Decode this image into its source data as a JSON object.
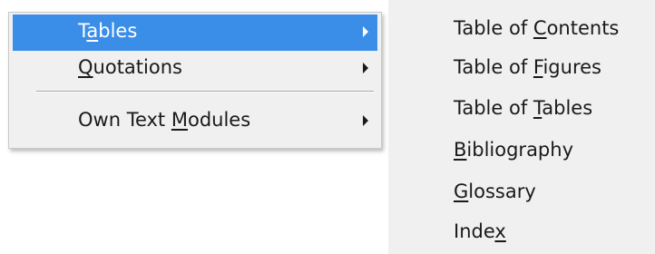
{
  "main_menu": {
    "items": [
      {
        "pre": "T",
        "key": "a",
        "post": "bles",
        "has_submenu": true,
        "selected": true
      },
      {
        "pre": "",
        "key": "Q",
        "post": "uotations",
        "has_submenu": true,
        "selected": false
      },
      {
        "pre": "Own Text ",
        "key": "M",
        "post": "odules",
        "has_submenu": true,
        "selected": false
      }
    ]
  },
  "submenu": {
    "items": [
      {
        "pre": "Table of ",
        "key": "C",
        "post": "ontents"
      },
      {
        "pre": "Table of ",
        "key": "F",
        "post": "igures"
      },
      {
        "pre": "Table of ",
        "key": "T",
        "post": "ables"
      },
      {
        "pre": "",
        "key": "B",
        "post": "ibliography"
      },
      {
        "pre": "",
        "key": "G",
        "post": "lossary"
      },
      {
        "pre": "Inde",
        "key": "x",
        "post": ""
      }
    ]
  },
  "colors": {
    "menu_background": "#f0f0f0",
    "selection_highlight": "#3a8ee8",
    "text": "#1a1a1a",
    "selected_text": "#ffffff"
  },
  "icons": {
    "submenu_arrow": "chevron-right-icon"
  }
}
